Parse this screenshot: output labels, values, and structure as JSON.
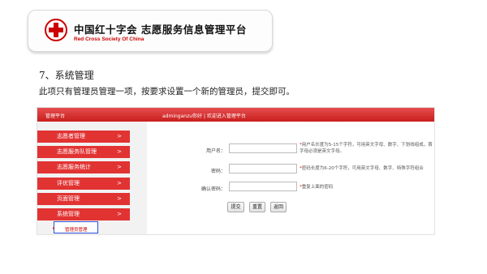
{
  "banner": {
    "title": "中国红十字会 志愿服务信息管理平台",
    "subtitle": "Red Cross Society Of China"
  },
  "document": {
    "heading": "7、系统管理",
    "paragraph": "此项只有管理员管理一项，按要求设置一个新的管理员，提交即可。"
  },
  "screenshot": {
    "sidebar_header": "管理平台",
    "menu": [
      {
        "label": "志愿者管理",
        "arrow": ">"
      },
      {
        "label": "志愿服务队管理",
        "arrow": ">"
      },
      {
        "label": "志愿服务统计",
        "arrow": ">"
      },
      {
        "label": "评优管理",
        "arrow": ">"
      },
      {
        "label": "页面管理",
        "arrow": ">"
      },
      {
        "label": "系统管理",
        "arrow": ">"
      }
    ],
    "submenu_item": "管理员管理",
    "main_header": "adminganzu你好 | 欢迎进入管理平台",
    "form": {
      "username_label": "用户名：",
      "username_hint": "用户名长度为5-15个字符，可用英文字母、数字、下划线组成，首字母必须是英文字母。",
      "password_label": "密码：",
      "password_hint": "密码长度为6-20个字符，可用英文字母、数字、特殊字符组合",
      "confirm_label": "确认密码：",
      "confirm_hint": "重复上面的密码",
      "star": "*"
    },
    "buttons": {
      "submit": "提交",
      "reset": "重置",
      "back": "返回"
    }
  },
  "colors": {
    "accent_red": "#e23333",
    "highlight_blue": "#2b4fd6"
  }
}
